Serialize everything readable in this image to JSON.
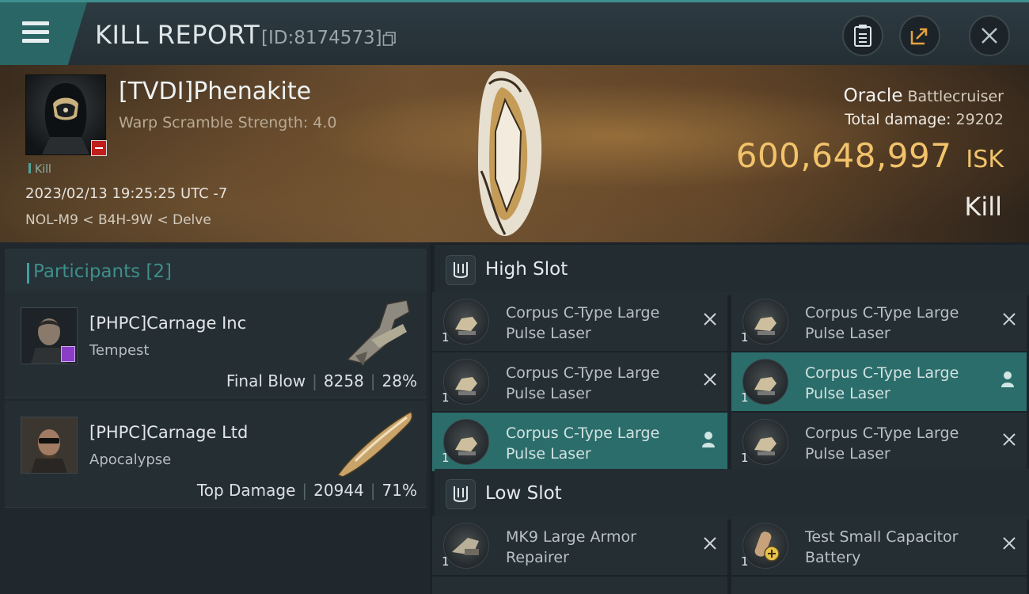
{
  "header": {
    "title": "KILL REPORT",
    "report_id": "[ID:8174573]",
    "icons": [
      "menu-icon",
      "copy-icon",
      "clipboard-icon",
      "share-icon",
      "close-icon"
    ]
  },
  "victim": {
    "name": "[TVDI]Phenakite",
    "warp": "Warp Scramble Strength: 4.0",
    "tag": "Kill",
    "datetime": "2023/02/13 19:25:25 UTC -7",
    "location": "NOL-M9 < B4H-9W < Delve",
    "ship_name": "Oracle",
    "ship_class": "Battlecruiser",
    "damage_label": "Total damage:",
    "damage_value": "29202",
    "isk_value": "600,648,997",
    "isk_unit": "ISK",
    "result": "Kill"
  },
  "participants": {
    "title": "Participants [2]",
    "rows": [
      {
        "name": "[PHPC]Carnage Inc",
        "ship": "Tempest",
        "role": "Final Blow",
        "damage": "8258",
        "percent": "28%"
      },
      {
        "name": "[PHPC]Carnage Ltd",
        "ship": "Apocalypse",
        "role": "Top Damage",
        "damage": "20944",
        "percent": "71%"
      }
    ]
  },
  "fittings": {
    "high_slot": {
      "title": "High Slot",
      "modules": [
        {
          "line1": "Corpus C-Type Large",
          "line2": "Pulse Laser",
          "qty": "1",
          "active": false
        },
        {
          "line1": "Corpus C-Type Large",
          "line2": "Pulse Laser",
          "qty": "1",
          "active": false
        },
        {
          "line1": "Corpus C-Type Large",
          "line2": "Pulse Laser",
          "qty": "1",
          "active": false
        },
        {
          "line1": "Corpus C-Type Large",
          "line2": "Pulse Laser",
          "qty": "1",
          "active": true
        },
        {
          "line1": "Corpus C-Type Large",
          "line2": "Pulse Laser",
          "qty": "1",
          "active": true
        },
        {
          "line1": "Corpus C-Type Large",
          "line2": "Pulse Laser",
          "qty": "1",
          "active": false
        }
      ]
    },
    "low_slot": {
      "title": "Low Slot",
      "modules": [
        {
          "line1": "MK9 Large Armor",
          "line2": "Repairer",
          "qty": "1"
        },
        {
          "line1": "Test Small Capacitor",
          "line2": "Battery",
          "qty": "1"
        }
      ]
    }
  },
  "colors": {
    "accent_teal": "#2b6d6b",
    "isk_gold": "#f2c36b",
    "header_bg": "#2d3a41"
  }
}
